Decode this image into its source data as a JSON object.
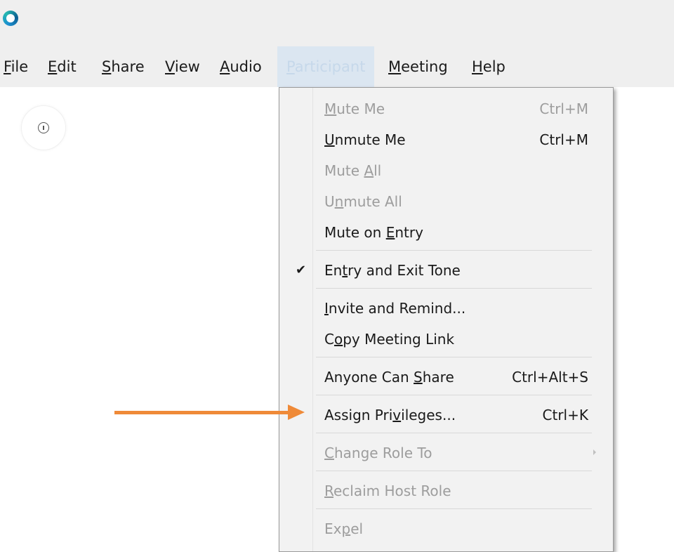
{
  "menubar": {
    "items": [
      {
        "pre": "",
        "ul": "F",
        "post": "ile"
      },
      {
        "pre": "",
        "ul": "E",
        "post": "dit"
      },
      {
        "pre": "",
        "ul": "S",
        "post": "hare"
      },
      {
        "pre": "",
        "ul": "V",
        "post": "iew"
      },
      {
        "pre": "",
        "ul": "A",
        "post": "udio"
      },
      {
        "pre": "",
        "ul": "P",
        "post": "articipant"
      },
      {
        "pre": "",
        "ul": "M",
        "post": "eeting"
      },
      {
        "pre": "",
        "ul": "H",
        "post": "elp"
      }
    ],
    "active_index": 5
  },
  "participant_menu": {
    "items": [
      {
        "pre": "",
        "ul": "M",
        "post": "ute Me",
        "shortcut": "Ctrl+M",
        "enabled": false,
        "checked": false
      },
      {
        "pre": "",
        "ul": "U",
        "post": "nmute Me",
        "shortcut": "Ctrl+M",
        "enabled": true,
        "checked": false
      },
      {
        "pre": "Mute ",
        "ul": "A",
        "post": "ll",
        "shortcut": "",
        "enabled": false,
        "checked": false
      },
      {
        "pre": "U",
        "ul": "n",
        "post": "mute All",
        "shortcut": "",
        "enabled": false,
        "checked": false
      },
      {
        "pre": "Mute on ",
        "ul": "E",
        "post": "ntry",
        "shortcut": "",
        "enabled": true,
        "checked": false
      },
      {
        "pre": "En",
        "ul": "t",
        "post": "ry and Exit Tone",
        "shortcut": "",
        "enabled": true,
        "checked": true
      },
      {
        "pre": "",
        "ul": "I",
        "post": "nvite and Remind...",
        "shortcut": "",
        "enabled": true,
        "checked": false
      },
      {
        "pre": "C",
        "ul": "o",
        "post": "py Meeting Link",
        "shortcut": "",
        "enabled": true,
        "checked": false
      },
      {
        "pre": "Anyone Can ",
        "ul": "S",
        "post": "hare",
        "shortcut": "Ctrl+Alt+S",
        "enabled": true,
        "checked": false
      },
      {
        "pre": "Assign Pri",
        "ul": "v",
        "post": "ileges...",
        "shortcut": "Ctrl+K",
        "enabled": true,
        "checked": false
      },
      {
        "pre": "",
        "ul": "C",
        "post": "hange Role To",
        "shortcut": "",
        "enabled": false,
        "checked": false,
        "submenu": true
      },
      {
        "pre": "",
        "ul": "R",
        "post": "eclaim Host Role",
        "shortcut": "",
        "enabled": false,
        "checked": false
      },
      {
        "pre": "Ex",
        "ul": "p",
        "post": "el",
        "shortcut": "",
        "enabled": false,
        "checked": false
      }
    ],
    "check_glyph": "✔"
  },
  "colors": {
    "annotation_arrow": "#ef8a38",
    "menu_background": "#f2f2f2",
    "disabled_text": "#9d9d9d",
    "active_menu_highlight": "#dbe6f1"
  },
  "icons": {
    "app_logo": "app-logo-icon",
    "info": "info-icon",
    "check": "checkmark-icon",
    "submenu": "submenu-arrow-icon",
    "annotation": "annotation-arrow"
  }
}
